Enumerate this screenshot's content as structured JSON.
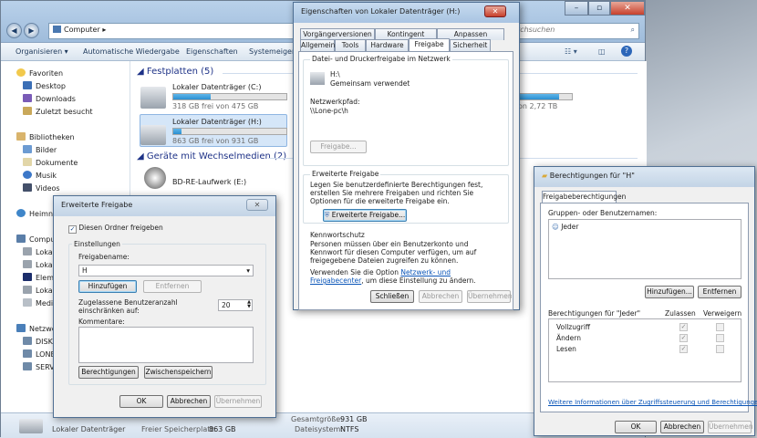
{
  "explorer": {
    "address": "Computer",
    "search_placeholder": "er durchsuchen",
    "commands": [
      "Organisieren ▾",
      "Automatische Wiedergabe",
      "Eigenschaften",
      "Systemeigens"
    ],
    "nav": {
      "favorites": "Favoriten",
      "fav_items": [
        "Desktop",
        "Downloads",
        "Zuletzt besucht"
      ],
      "libraries": "Bibliotheken",
      "lib_items": [
        "Bilder",
        "Dokumente",
        "Musik",
        "Videos"
      ],
      "homegroup": "Heimne",
      "computer": "Compu",
      "computer_items": [
        "Lokale",
        "Lokale",
        "Eleme",
        "Lokale",
        "Media"
      ],
      "network": "Netzwe",
      "network_items": [
        "DISKS",
        "LONE",
        "SERVE"
      ]
    },
    "sections": {
      "hdd_header": "Festplatten (5)",
      "removable_header": "Geräte mit Wechselmedien (2)"
    },
    "drives": [
      {
        "name": "Lokaler Datenträger (C:)",
        "free": "318 GB frei von 475 GB",
        "used_fraction": 0.33
      },
      {
        "name": "Lokaler Datenträger (H:)",
        "free": "863 GB frei von 931 GB",
        "used_fraction": 0.07
      },
      {
        "name": "BD-RE-Laufwerk (E:)"
      }
    ],
    "right_drive": {
      "free": "on 2,72 TB",
      "used_fraction": 0.75
    },
    "status": {
      "name": "Lokaler Datenträger",
      "free_label": "Freier Speicherplatz:",
      "free_value": "863 GB",
      "total_label": "Gesamtgröße:",
      "total_value": "931 GB",
      "fs_label": "Dateisystem:",
      "fs_value": "NTFS"
    }
  },
  "props": {
    "title": "Eigenschaften von Lokaler Datenträger (H:)",
    "tabs_row1": [
      "Vorgängerversionen",
      "Kontingent",
      "Anpassen"
    ],
    "tabs_row2": [
      "Allgemein",
      "Tools",
      "Hardware",
      "Freigabe",
      "Sicherheit"
    ],
    "section_share": "Datei- und Druckerfreigabe im Netzwerk",
    "share_name": "H:\\",
    "share_state": "Gemeinsam verwendet",
    "path_label": "Netzwerkpfad:",
    "path_value": "\\\\Lone-pc\\h",
    "share_button": "Freigabe...",
    "section_adv": "Erweiterte Freigabe",
    "adv_text": "Legen Sie benutzerdefinierte Berechtigungen fest, erstellen Sie mehrere Freigaben und richten Sie Optionen für die erweiterte Freigabe ein.",
    "adv_button": "Erweiterte Freigabe...",
    "section_pw": "Kennwortschutz",
    "pw_text": "Personen müssen über ein Benutzerkonto und Kennwort für diesen Computer verfügen, um auf freigegebene Dateien zugreifen zu können.",
    "pw_text2_pre": "Verwenden Sie die Option ",
    "pw_link": "Netzwerk- und Freigabecenter",
    "pw_text2_post": ", um diese Einstellung zu ändern.",
    "btn_close": "Schließen",
    "btn_cancel": "Abbrechen",
    "btn_apply": "Übernehmen"
  },
  "adv": {
    "title": "Erweiterte Freigabe",
    "share_checkbox": "Diesen Ordner freigeben",
    "settings_label": "Einstellungen",
    "sharename_label": "Freigabename:",
    "sharename_value": "H",
    "btn_add": "Hinzufügen",
    "btn_remove": "Entfernen",
    "users_label": "Zugelassene Benutzeranzahl einschränken auf:",
    "users_value": "20",
    "comments_label": "Kommentare:",
    "btn_permissions": "Berechtigungen",
    "btn_cache": "Zwischenspeichern",
    "btn_ok": "OK",
    "btn_cancel": "Abbrechen",
    "btn_apply": "Übernehmen"
  },
  "perm": {
    "title": "Berechtigungen für \"H\"",
    "tab": "Freigabeberechtigungen",
    "group_label": "Gruppen- oder Benutzernamen:",
    "users": [
      "Jeder"
    ],
    "btn_add": "Hinzufügen...",
    "btn_remove": "Entfernen",
    "perm_for": "Berechtigungen für \"Jeder\"",
    "col_allow": "Zulassen",
    "col_deny": "Verweigern",
    "rows": [
      {
        "name": "Vollzugriff",
        "allow": true,
        "deny": false
      },
      {
        "name": "Ändern",
        "allow": true,
        "deny": false
      },
      {
        "name": "Lesen",
        "allow": true,
        "deny": false
      }
    ],
    "link": "Weitere Informationen über Zugriffssteuerung und Berechtigungen",
    "btn_ok": "OK",
    "btn_cancel": "Abbrechen",
    "btn_apply": "Übernehmen"
  },
  "colors": {
    "accent": "#2b8fd1",
    "title_bar": "#a9c4e2",
    "close": "#c7402c"
  }
}
